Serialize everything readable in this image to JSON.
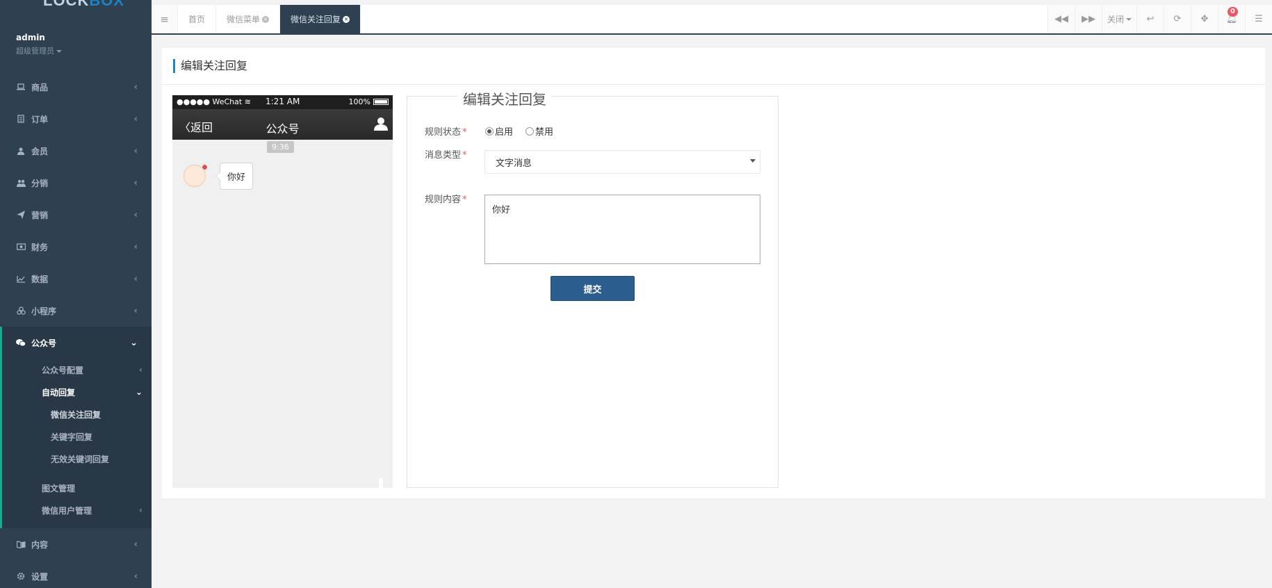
{
  "sidebar": {
    "logo": {
      "part1": "LOCK",
      "part2": "BOX"
    },
    "user": {
      "name": "admin",
      "role": "超级管理员"
    },
    "items": [
      {
        "label": "商品",
        "icon": "laptop-icon"
      },
      {
        "label": "订单",
        "icon": "file-icon"
      },
      {
        "label": "会员",
        "icon": "user-icon"
      },
      {
        "label": "分销",
        "icon": "users-icon"
      },
      {
        "label": "营销",
        "icon": "send-icon"
      },
      {
        "label": "财务",
        "icon": "money-icon"
      },
      {
        "label": "数据",
        "icon": "line-chart-icon"
      },
      {
        "label": "小程序",
        "icon": "cubes-icon"
      }
    ],
    "open_group": {
      "label": "公众号",
      "icon": "wechat-icon",
      "children": [
        {
          "label": "公众号配置"
        },
        {
          "label": "自动回复",
          "children": [
            "微信关注回复",
            "关键字回复",
            "无效关键词回复"
          ]
        },
        {
          "label": "图文管理"
        },
        {
          "label": "微信用户管理"
        }
      ]
    },
    "bottom_items": [
      {
        "label": "内容",
        "icon": "book-icon"
      },
      {
        "label": "设置",
        "icon": "cog-icon"
      }
    ]
  },
  "topbar": {
    "tabs": [
      {
        "label": "首页",
        "closable": false,
        "active": false
      },
      {
        "label": "微信菜单",
        "closable": true,
        "active": false
      },
      {
        "label": "微信关注回复",
        "closable": true,
        "active": true
      }
    ],
    "close_label": "关闭",
    "notification_count": "0"
  },
  "page": {
    "title": "编辑关注回复"
  },
  "preview": {
    "carrier": "●●●●● WeChat",
    "time": "1:21 AM",
    "battery": "100%",
    "back": "返回",
    "account": "公众号",
    "chat_time": "9:36",
    "message": "你好"
  },
  "form": {
    "legend": "编辑关注回复",
    "status_label": "规则状态",
    "status_options": [
      "启用",
      "禁用"
    ],
    "status_selected": "启用",
    "type_label": "消息类型",
    "type_value": "文字消息",
    "content_label": "规则内容",
    "content_value": "你好",
    "submit_label": "提交"
  },
  "colors": {
    "sidebar": "#2f4050",
    "accent": "#1c84c6",
    "submit": "#2c5d8f",
    "badge": "#ed5565"
  }
}
